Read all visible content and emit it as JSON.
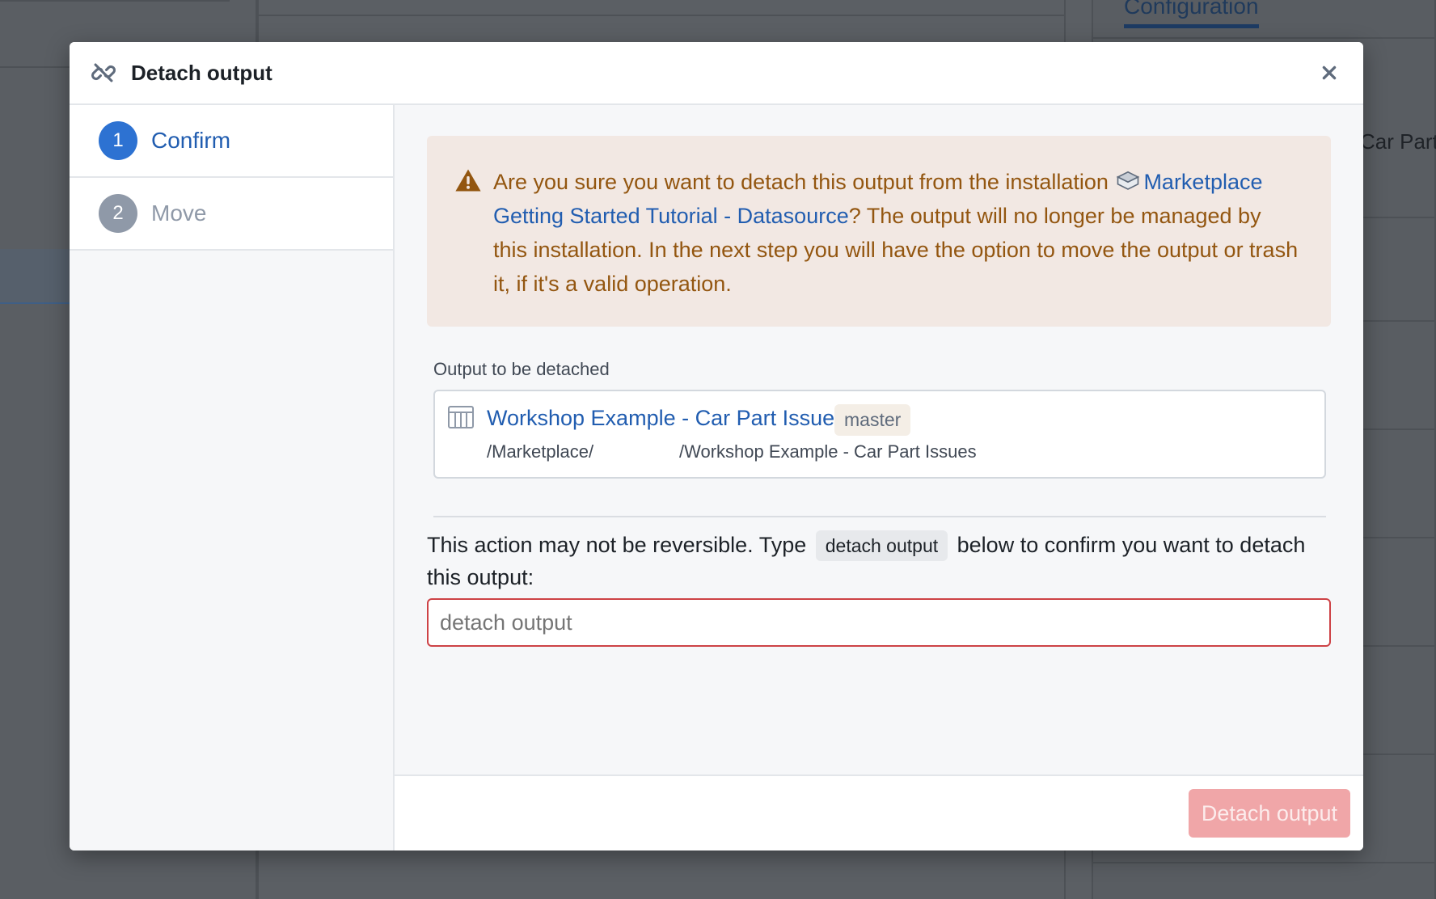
{
  "background": {
    "tab_label": "Configuration",
    "side_text": "Car Part"
  },
  "modal": {
    "title": "Detach output",
    "header_icon": "unlink-icon",
    "close_icon": "close-icon"
  },
  "steps": [
    {
      "number": "1",
      "label": "Confirm",
      "state": "active"
    },
    {
      "number": "2",
      "label": "Move",
      "state": "inactive"
    }
  ],
  "callout": {
    "icon": "warning-icon",
    "text_before": "Are you sure you want to detach this output from the installation ",
    "installation_icon": "marketplace-cube-icon",
    "installation_name": "Marketplace Getting Started Tutorial - Datasource",
    "text_after": "? The output will no longer be managed by this installation. In the next step you will have the option to move the output or trash it, if it's a valid operation."
  },
  "output": {
    "section_label": "Output to be detached",
    "icon": "table-icon",
    "name": "Workshop Example - Car Part Issues",
    "branch": "master",
    "path_prefix": "/Marketplace/",
    "path_suffix": "/Workshop Example - Car Part Issues"
  },
  "confirmation": {
    "text_before": "This action may not be reversible. Type ",
    "code": "detach output",
    "text_after": " below to confirm you want to detach this output:",
    "input_placeholder": "detach output",
    "input_value": ""
  },
  "footer": {
    "submit_label": "Detach output"
  },
  "colors": {
    "accent": "#2d72d2",
    "warning_text": "#935610",
    "callout_bg": "#f2e8e3",
    "danger_border": "#cd4246",
    "danger_disabled_bg": "#f0a6a8"
  }
}
